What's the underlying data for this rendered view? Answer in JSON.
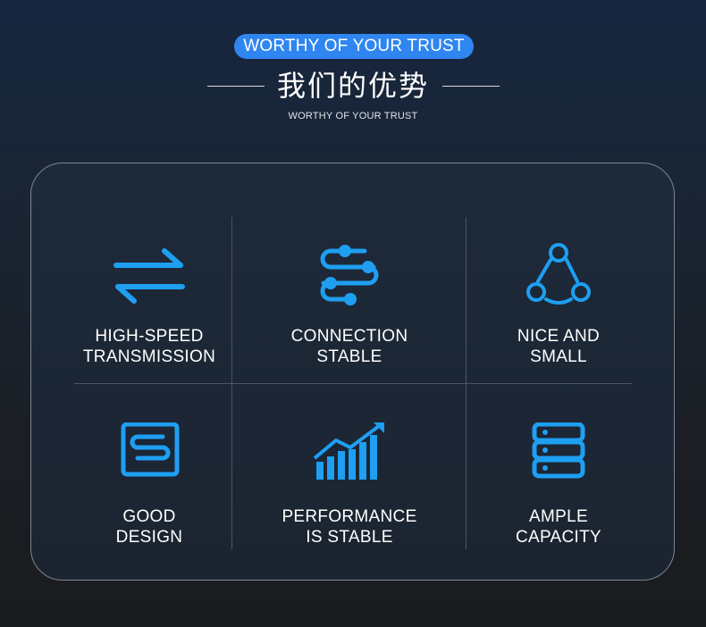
{
  "header": {
    "badge": "WORTHY OF YOUR TRUST",
    "title": "我们的优势",
    "subtitle": "WORTHY OF YOUR TRUST"
  },
  "accent_color": "#1e9ff2",
  "badge_color": "#2f86f0",
  "features": [
    {
      "line1": "HIGH-SPEED",
      "line2": "TRANSMISSION",
      "icon": "transfer-arrows-icon"
    },
    {
      "line1": "CONNECTION",
      "line2": "STABLE",
      "icon": "connection-nodes-icon"
    },
    {
      "line1": "NICE AND",
      "line2": "SMALL",
      "icon": "network-triangle-icon"
    },
    {
      "line1": "GOOD",
      "line2": "DESIGN",
      "icon": "serpentine-design-icon"
    },
    {
      "line1": "PERFORMANCE",
      "line2": "IS STABLE",
      "icon": "growth-chart-icon"
    },
    {
      "line1": "AMPLE",
      "line2": "CAPACITY",
      "icon": "server-stack-icon"
    }
  ]
}
